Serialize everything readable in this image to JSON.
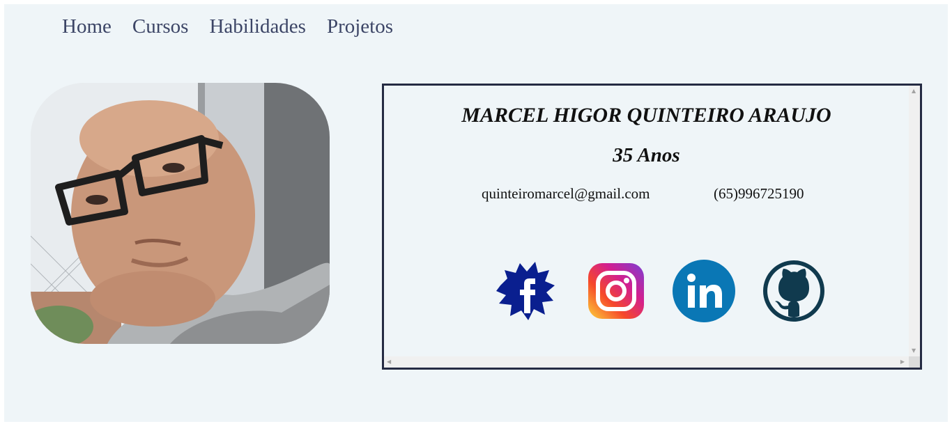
{
  "nav": {
    "items": [
      "Home",
      "Cursos",
      "Habilidades",
      "Projetos"
    ]
  },
  "profile": {
    "photo_icon": "profile-photo",
    "name": "MARCEL HIGOR QUINTEIRO ARAUJO",
    "age": "35 Anos",
    "email": "quinteiromarcel@gmail.com",
    "phone": "(65)996725190"
  },
  "social": {
    "icons": [
      "facebook-icon",
      "instagram-icon",
      "linkedin-icon",
      "github-icon"
    ]
  },
  "colors": {
    "page_bg": "#eff5f8",
    "nav_text": "#3c4566",
    "box_border": "#252b43",
    "facebook": "#0a1f8f",
    "linkedin": "#0a77b5",
    "github": "#103a4e"
  }
}
